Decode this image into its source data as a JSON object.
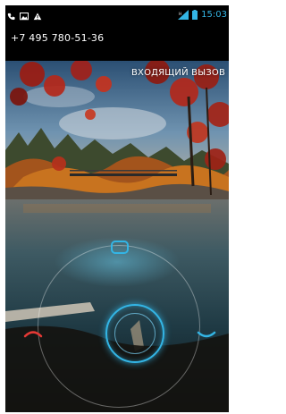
{
  "status_bar": {
    "left_icons": [
      "phone-icon",
      "image-notification-icon",
      "warning-icon"
    ],
    "right_icons": [
      "signal-icon",
      "battery-icon"
    ],
    "time": "15:03",
    "accent_color": "#33b5e5"
  },
  "caller": {
    "number": "+7 495 780-51-36"
  },
  "call_state": "ВХОДЯЩИЙ ВЫЗОВ",
  "unlock": {
    "targets": [
      "message-target-icon",
      "decline-call-icon",
      "answer-call-icon"
    ],
    "decline_color": "#e53935",
    "answer_color": "#33b5e5"
  }
}
